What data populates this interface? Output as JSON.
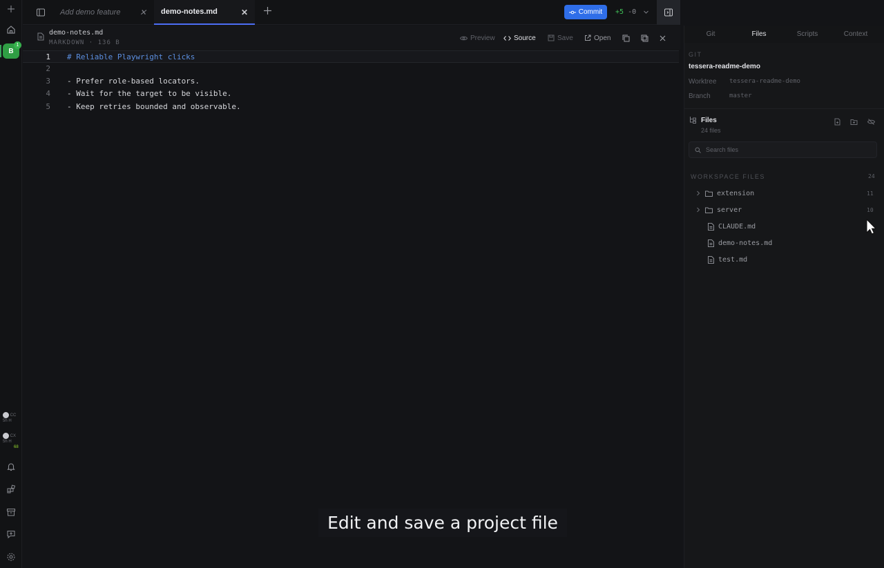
{
  "workspace": {
    "badge": "B",
    "count": "1"
  },
  "usage": [
    {
      "code": "CC",
      "line2": "5h   H",
      "line3": ""
    },
    {
      "code": "CX",
      "line2": "5h   H",
      "line3": "68"
    }
  ],
  "tabs": [
    {
      "label": "Add demo feature",
      "active": false
    },
    {
      "label": "demo-notes.md",
      "active": true
    }
  ],
  "toolbar": {
    "commit_label": "Commit",
    "diff_added": "+5",
    "diff_removed": "-0"
  },
  "editor": {
    "file_name": "demo-notes.md",
    "file_meta": "MARKDOWN · 136 B",
    "actions": {
      "preview": "Preview",
      "source": "Source",
      "save": "Save",
      "open": "Open"
    },
    "lines": [
      {
        "n": "1",
        "text": "# Reliable Playwright clicks"
      },
      {
        "n": "2",
        "text": ""
      },
      {
        "n": "3",
        "text": "- Prefer role-based locators."
      },
      {
        "n": "4",
        "text": "- Wait for the target to be visible."
      },
      {
        "n": "5",
        "text": "- Keep retries bounded and observable."
      }
    ]
  },
  "panel": {
    "tabs": [
      "Git",
      "Files",
      "Scripts",
      "Context"
    ],
    "git": {
      "label": "GIT",
      "repo": "tessera-readme-demo",
      "worktree_key": "Worktree",
      "worktree_value": "tessera-readme-demo",
      "branch_key": "Branch",
      "branch_value": "master"
    },
    "files": {
      "title": "Files",
      "subtitle": "24 files",
      "search_placeholder": "Search files",
      "section_label": "WORKSPACE FILES",
      "section_count": "24",
      "tree": [
        {
          "name": "extension",
          "type": "folder",
          "count": "11"
        },
        {
          "name": "server",
          "type": "folder",
          "count": "10"
        },
        {
          "name": "CLAUDE.md",
          "type": "file",
          "count": ""
        },
        {
          "name": "demo-notes.md",
          "type": "file",
          "count": ""
        },
        {
          "name": "test.md",
          "type": "file",
          "count": ""
        }
      ]
    }
  },
  "caption": "Edit and save a project file"
}
